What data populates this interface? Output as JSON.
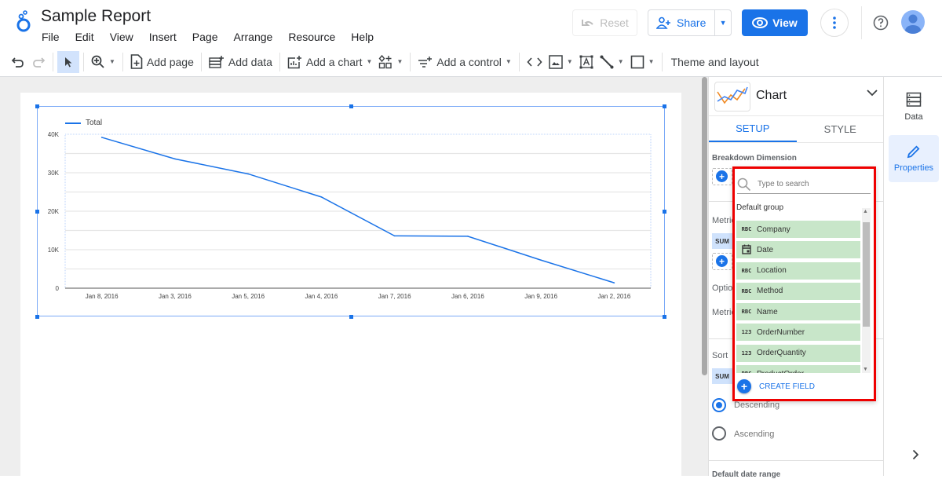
{
  "app": {
    "title": "Sample Report",
    "menu": [
      "File",
      "Edit",
      "View",
      "Insert",
      "Page",
      "Arrange",
      "Resource",
      "Help"
    ],
    "buttons": {
      "reset": "Reset",
      "share": "Share",
      "view": "View"
    }
  },
  "toolbar": {
    "add_page": "Add page",
    "add_data": "Add data",
    "add_chart": "Add a chart",
    "add_control": "Add a control",
    "theme_layout": "Theme and layout"
  },
  "panel": {
    "chart_type": "Chart",
    "tabs": [
      "SETUP",
      "STYLE"
    ],
    "active_tab": "SETUP",
    "breakdown_dimension": "Breakdown Dimension",
    "metric_label": "Metric",
    "metric_agg": "SUM",
    "optional_metrics": "Optional metrics",
    "metric_sliders": "Metric sliders",
    "sort_label": "Sort",
    "sort_agg": "SUM",
    "sort_options": [
      "Descending",
      "Ascending"
    ],
    "sort_selected": "Descending",
    "default_date_range": "Default date range"
  },
  "rail": {
    "items": [
      {
        "label": "Data",
        "icon": "database-icon",
        "active": false
      },
      {
        "label": "Properties",
        "icon": "pencil-icon",
        "active": true
      }
    ]
  },
  "field_picker": {
    "search_placeholder": "Type to search",
    "group": "Default group",
    "fields": [
      {
        "type": "RBC",
        "name": "Company"
      },
      {
        "type": "date",
        "name": "Date"
      },
      {
        "type": "RBC",
        "name": "Location"
      },
      {
        "type": "RBC",
        "name": "Method"
      },
      {
        "type": "RBC",
        "name": "Name"
      },
      {
        "type": "123",
        "name": "OrderNumber"
      },
      {
        "type": "123",
        "name": "OrderQuantity"
      },
      {
        "type": "RBC",
        "name": "ProductOrder"
      }
    ],
    "create_field": "CREATE FIELD"
  },
  "chart_data": {
    "type": "line",
    "title": "",
    "xlabel": "",
    "ylabel": "",
    "categories": [
      "Jan 8, 2016",
      "Jan 3, 2016",
      "Jan 5, 2016",
      "Jan 4, 2016",
      "Jan 7, 2016",
      "Jan 6, 2016",
      "Jan 9, 2016",
      "Jan 2, 2016"
    ],
    "series": [
      {
        "name": "Total",
        "color": "#1a73e8",
        "values": [
          39200,
          33600,
          29700,
          23700,
          13600,
          13500,
          7300,
          1400
        ]
      }
    ],
    "ylim": [
      0,
      40000
    ],
    "yticks": [
      0,
      10000,
      20000,
      30000,
      40000
    ],
    "ytick_labels": [
      "0",
      "10K",
      "20K",
      "30K",
      "40K"
    ],
    "grid": true,
    "legend": "top-left"
  }
}
